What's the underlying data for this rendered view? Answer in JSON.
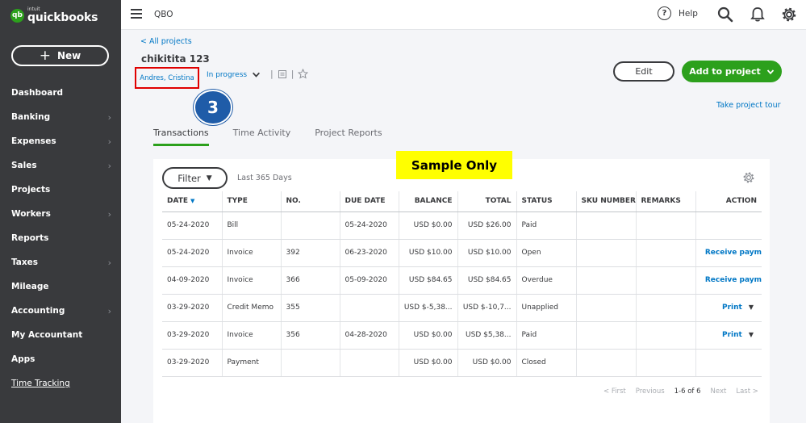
{
  "sidebar": {
    "logo_mark": "qb",
    "logo_intuit": "intuit",
    "logo_name": "quickbooks",
    "new_label": "New",
    "items": [
      {
        "label": "Dashboard",
        "chevron": false
      },
      {
        "label": "Banking",
        "chevron": true
      },
      {
        "label": "Expenses",
        "chevron": true
      },
      {
        "label": "Sales",
        "chevron": true
      },
      {
        "label": "Projects",
        "chevron": false
      },
      {
        "label": "Workers",
        "chevron": true
      },
      {
        "label": "Reports",
        "chevron": false
      },
      {
        "label": "Taxes",
        "chevron": true
      },
      {
        "label": "Mileage",
        "chevron": false
      },
      {
        "label": "Accounting",
        "chevron": true
      },
      {
        "label": "My Accountant",
        "chevron": false
      },
      {
        "label": "Apps",
        "chevron": false
      },
      {
        "label": "Time Tracking",
        "chevron": false
      }
    ]
  },
  "topbar": {
    "company": "QBO",
    "help_label": "Help",
    "icons": [
      "menu-icon",
      "help-icon",
      "search-icon",
      "bell-icon",
      "gear-icon"
    ]
  },
  "project": {
    "back_link": "< All projects",
    "title": "chikitita 123",
    "customer": "Andres, Cristina",
    "status": "In progress",
    "step_number": "3",
    "edit_label": "Edit",
    "add_label": "Add to project",
    "tour_label": "Take project tour"
  },
  "tabs": [
    "Transactions",
    "Time Activity",
    "Project Reports"
  ],
  "banner": "Sample Only",
  "table": {
    "filter_label": "Filter",
    "range": "Last 365 Days",
    "columns": [
      "DATE",
      "TYPE",
      "NO.",
      "DUE DATE",
      "BALANCE",
      "TOTAL",
      "STATUS",
      "SKU NUMBER",
      "REMARKS",
      "ACTION"
    ],
    "rows": [
      {
        "date": "05-24-2020",
        "type": "Bill",
        "no": "",
        "due": "05-24-2020",
        "balance": "USD $0.00",
        "total": "USD $26.00",
        "status": "Paid",
        "sku": "",
        "remarks": "",
        "action": ""
      },
      {
        "date": "05-24-2020",
        "type": "Invoice",
        "no": "392",
        "due": "06-23-2020",
        "balance": "USD $10.00",
        "total": "USD $10.00",
        "status": "Open",
        "sku": "",
        "remarks": "",
        "action": "Receive paym"
      },
      {
        "date": "04-09-2020",
        "type": "Invoice",
        "no": "366",
        "due": "05-09-2020",
        "balance": "USD $84.65",
        "total": "USD $84.65",
        "status": "Overdue",
        "sku": "",
        "remarks": "",
        "action": "Receive paym"
      },
      {
        "date": "03-29-2020",
        "type": "Credit Memo",
        "no": "355",
        "due": "",
        "balance": "USD $-5,38...",
        "total": "USD $-10,7...",
        "status": "Unapplied",
        "sku": "",
        "remarks": "",
        "action": "Print"
      },
      {
        "date": "03-29-2020",
        "type": "Invoice",
        "no": "356",
        "due": "04-28-2020",
        "balance": "USD $0.00",
        "total": "USD $5,38...",
        "status": "Paid",
        "sku": "",
        "remarks": "",
        "action": "Print"
      },
      {
        "date": "03-29-2020",
        "type": "Payment",
        "no": "",
        "due": "",
        "balance": "USD $0.00",
        "total": "USD $0.00",
        "status": "Closed",
        "sku": "",
        "remarks": "",
        "action": ""
      }
    ]
  },
  "pager": {
    "first": "< First",
    "previous": "Previous",
    "count": "1-6 of 6",
    "next": "Next",
    "last": "Last >"
  },
  "colors": {
    "sidebar_bg": "#393a3d",
    "brand_green": "#2ca01c",
    "link_blue": "#0077c5",
    "highlight_red": "#e00000",
    "badge_blue": "#1f5ca8",
    "banner_yellow": "#ffff00"
  }
}
